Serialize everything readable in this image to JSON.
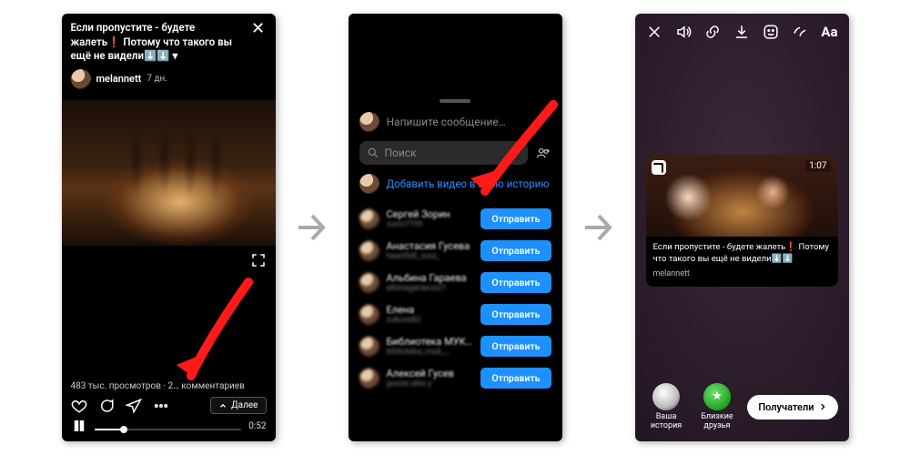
{
  "screen1": {
    "caption": "Если пропустите - будете жалеть❗ Потому что такого вы ещё не видели⬇️⬇️ ▾",
    "username": "melannett",
    "age": "7 дн.",
    "views_line": "483 тыс. просмотров · 2… комментариев",
    "next_label": "Далее",
    "duration": "0:52"
  },
  "screen2": {
    "write_message": "Напишите сообщение…",
    "search_placeholder": "Поиск",
    "add_story": "Добавить видео в свою историю",
    "send_label": "Отправить",
    "contacts": [
      {
        "name": "Сергей Зорин",
        "handle": "zorin7799"
      },
      {
        "name": "Анастасия Гусева",
        "handle": "heartfelt_soul_"
      },
      {
        "name": "Альбина Гараева",
        "handle": "albinagaraeva21"
      },
      {
        "name": "Елена",
        "handle": "zukove82"
      },
      {
        "name": "Библиотека МУК…",
        "handle": "biblioteka_muk_…"
      },
      {
        "name": "Алексей Гусев",
        "handle": "goose.alex.y"
      }
    ]
  },
  "screen3": {
    "aa": "Aa",
    "card_time": "1:07",
    "card_caption": "Если пропустите - будете жалеть❗ Потому что такого вы ещё не видели⬇️⬇️",
    "card_user": "melannett",
    "your_story": "Ваша история",
    "close_friends": "Близкие друзья",
    "recipients": "Получатели"
  }
}
